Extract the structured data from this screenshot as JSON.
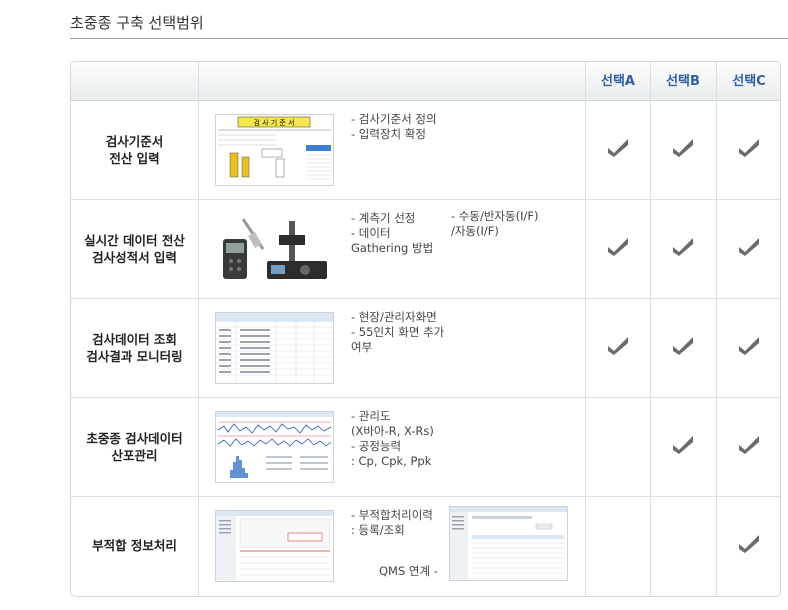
{
  "page": {
    "title": "초중종 구축 선택범위"
  },
  "header": {
    "options": [
      "선택A",
      "선택B",
      "선택C"
    ]
  },
  "rows": [
    {
      "label": "검사기준서\n전산 입력",
      "desc1": "- 검사기준서 정의\n- 입력장치 확정",
      "thumb_title": "검 사 기 준 서",
      "checks": [
        true,
        true,
        true
      ]
    },
    {
      "label": "실시간 데이터 전산\n검사성적서 입력",
      "desc1": "- 계측기 선정\n- 데이터\n  Gathering 방법",
      "desc2": "- 수동/반자동(I/F)\n  /자동(I/F)",
      "checks": [
        true,
        true,
        true
      ]
    },
    {
      "label": "검사데이터 조회\n검사결과 모니터링",
      "desc1": "- 현장/관리자화면\n- 55인치 화면 추가\n  여부",
      "checks": [
        true,
        true,
        true
      ]
    },
    {
      "label": "초중종 검사데이터\n산포관리",
      "desc1": "- 관리도\n  (X바아-R, X-Rs)\n- 공정능력\n  : Cp, Cpk, Ppk",
      "checks": [
        false,
        true,
        true
      ]
    },
    {
      "label": "부적합 정보처리",
      "desc1": "- 부적합처리이력\n  : 등록/조회",
      "desc2": "QMS 연계 -",
      "checks": [
        false,
        false,
        true
      ]
    }
  ]
}
